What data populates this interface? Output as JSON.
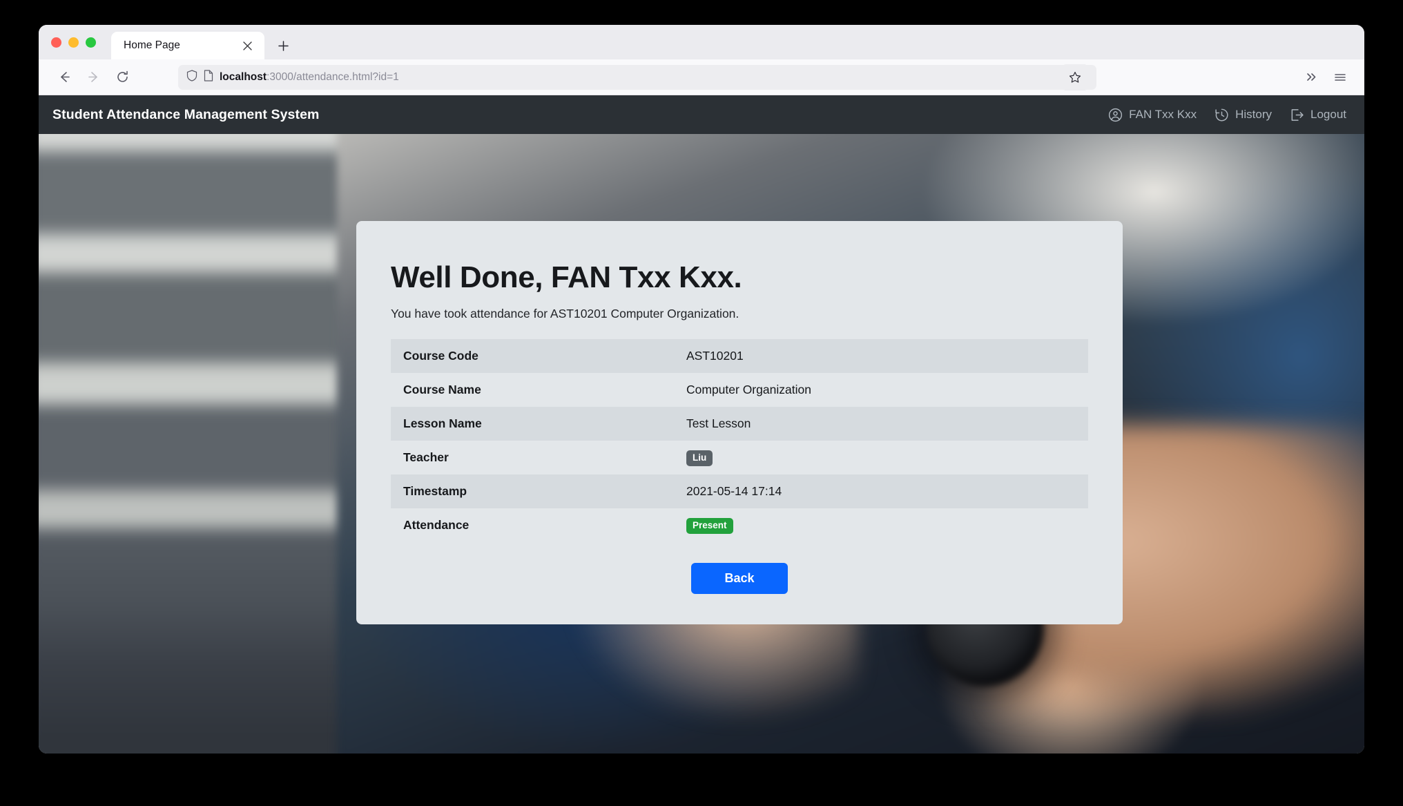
{
  "browser": {
    "tab": {
      "title": "Home Page",
      "close_label": "×"
    },
    "new_tab_label": "+",
    "nav": {
      "back_label": "Back",
      "forward_label": "Forward",
      "reload_label": "Reload",
      "bookmark_label": "Bookmark this page",
      "overflow_label": "More tools",
      "menu_label": "Open application menu"
    },
    "url": {
      "host": "localhost",
      "path": ":3000/attendance.html?id=1",
      "full": "localhost:3000/attendance.html?id=1"
    },
    "traffic_lights": {
      "close": "#ff5f57",
      "minimize": "#febc2e",
      "zoom": "#28c840"
    }
  },
  "navbar": {
    "brand": "Student Attendance Management System",
    "links": [
      {
        "label": "FAN Txx Kxx",
        "icon": "account-circle-icon"
      },
      {
        "label": "History",
        "icon": "history-icon"
      },
      {
        "label": "Logout",
        "icon": "logout-icon"
      }
    ]
  },
  "card": {
    "title": "Well Done, FAN Txx Kxx.",
    "subtitle": "You have took attendance for AST10201 Computer Organization.",
    "rows": [
      {
        "label": "Course Code",
        "value": "AST10201",
        "type": "text"
      },
      {
        "label": "Course Name",
        "value": "Computer Organization",
        "type": "text"
      },
      {
        "label": "Lesson Name",
        "value": "Test Lesson",
        "type": "text"
      },
      {
        "label": "Teacher",
        "value": "Liu",
        "type": "badge-secondary"
      },
      {
        "label": "Timestamp",
        "value": "2021-05-14 17:14",
        "type": "text"
      },
      {
        "label": "Attendance",
        "value": "Present",
        "type": "badge-success"
      }
    ],
    "back_button": "Back"
  },
  "colors": {
    "navbar_bg": "#2b3035",
    "card_bg": "#e3e7ea",
    "row_stripe": "#d6dbdf",
    "badge_secondary": "#5a6268",
    "badge_success": "#22a13c",
    "primary_button": "#0a66ff"
  }
}
